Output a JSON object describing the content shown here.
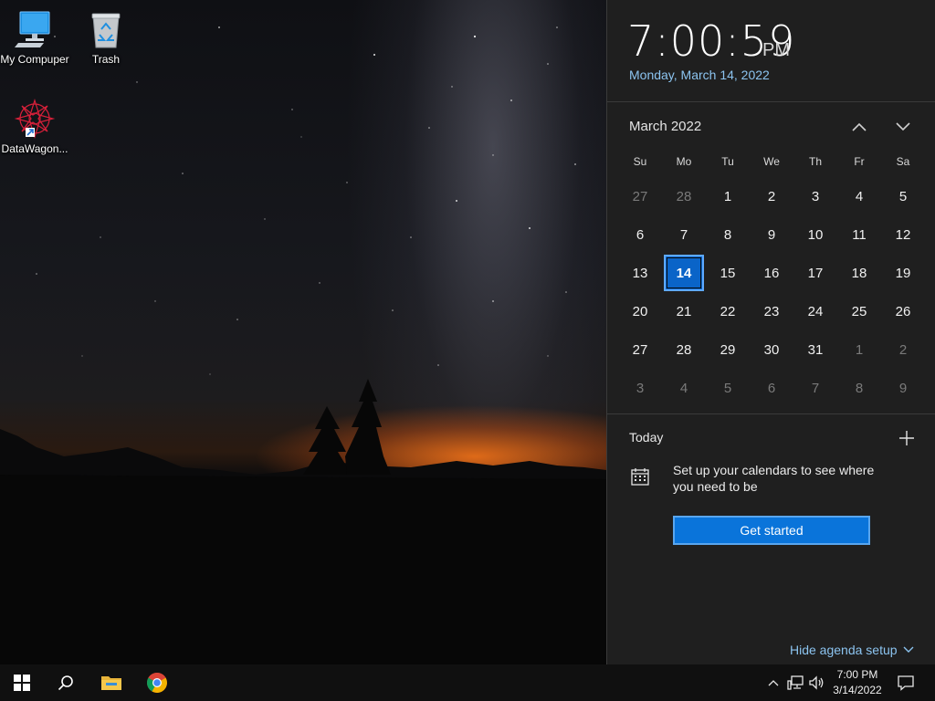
{
  "desktop": {
    "icons": [
      {
        "label": "My Compuper",
        "icon": "monitor-icon"
      },
      {
        "label": "Trash",
        "icon": "recycle-bin-icon"
      },
      {
        "label": "DataWagon...",
        "icon": "app-shortcut-icon"
      }
    ]
  },
  "flyout": {
    "time": "7:00:59",
    "ampm": "PM",
    "long_date": "Monday, March 14, 2022",
    "calendar": {
      "month_label": "March 2022",
      "weekdays": [
        "Su",
        "Mo",
        "Tu",
        "We",
        "Th",
        "Fr",
        "Sa"
      ],
      "days": [
        {
          "n": "27",
          "muted": true
        },
        {
          "n": "28",
          "muted": true
        },
        {
          "n": "1"
        },
        {
          "n": "2"
        },
        {
          "n": "3"
        },
        {
          "n": "4"
        },
        {
          "n": "5"
        },
        {
          "n": "6"
        },
        {
          "n": "7"
        },
        {
          "n": "8"
        },
        {
          "n": "9"
        },
        {
          "n": "10"
        },
        {
          "n": "11"
        },
        {
          "n": "12"
        },
        {
          "n": "13"
        },
        {
          "n": "14",
          "today": true
        },
        {
          "n": "15"
        },
        {
          "n": "16"
        },
        {
          "n": "17"
        },
        {
          "n": "18"
        },
        {
          "n": "19"
        },
        {
          "n": "20"
        },
        {
          "n": "21"
        },
        {
          "n": "22"
        },
        {
          "n": "23"
        },
        {
          "n": "24"
        },
        {
          "n": "25"
        },
        {
          "n": "26"
        },
        {
          "n": "27"
        },
        {
          "n": "28"
        },
        {
          "n": "29"
        },
        {
          "n": "30"
        },
        {
          "n": "31"
        },
        {
          "n": "1",
          "muted": true
        },
        {
          "n": "2",
          "muted": true
        },
        {
          "n": "3",
          "muted": true
        },
        {
          "n": "4",
          "muted": true
        },
        {
          "n": "5",
          "muted": true
        },
        {
          "n": "6",
          "muted": true
        },
        {
          "n": "7",
          "muted": true
        },
        {
          "n": "8",
          "muted": true
        },
        {
          "n": "9",
          "muted": true
        }
      ]
    },
    "agenda": {
      "today_label": "Today",
      "setup_text": "Set up your calendars to see where you need to be",
      "get_started_label": "Get started",
      "hide_label": "Hide agenda setup"
    }
  },
  "taskbar": {
    "clock_time": "7:00 PM",
    "clock_date": "3/14/2022",
    "pinned": [
      "start-icon",
      "search-icon",
      "file-explorer-icon",
      "chrome-icon"
    ],
    "tray": [
      "chevron-up-icon",
      "network-icon",
      "volume-icon",
      "notification-icon"
    ]
  },
  "colors": {
    "accent": "#0a74da",
    "link": "#8cc4f0",
    "panel": "#1f1f1f",
    "taskbar": "#101010"
  }
}
